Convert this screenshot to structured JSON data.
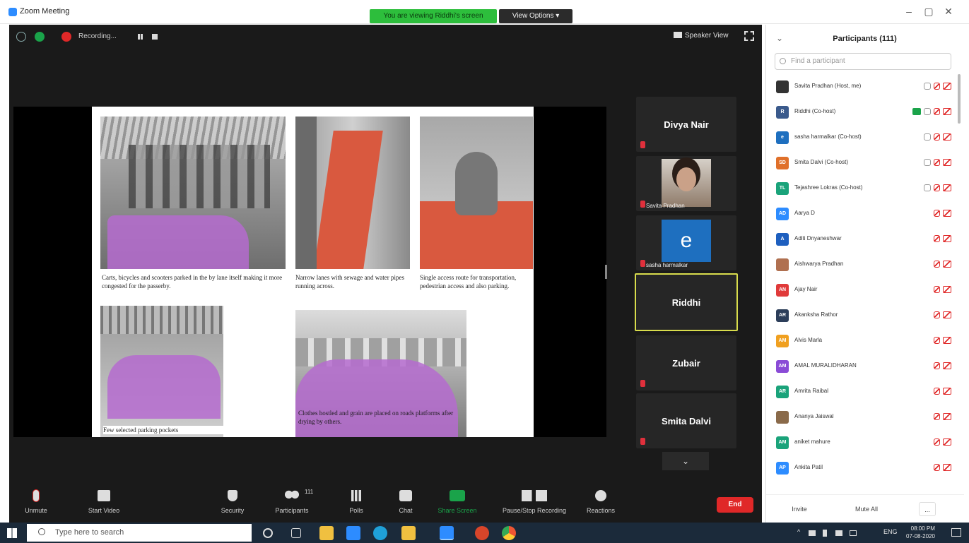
{
  "window": {
    "title": "Zoom Meeting",
    "share_banner": "You are viewing Riddhi's screen",
    "view_options": "View Options ▾",
    "minimize": "–",
    "maximize": "▢",
    "close": "✕"
  },
  "topbar": {
    "recording_label": "Recording...",
    "speaker_view": "Speaker View"
  },
  "slide": {
    "caption_1": "Carts, bicycles and scooters parked in the by lane itself making it more congested for the passerby.",
    "caption_2": "Narrow lanes with sewage and water pipes running across.",
    "caption_3": "Single access route for transportation, pedestrian access and also parking.",
    "caption_4": "Few selected parking pockets",
    "caption_5": "Clothes hostled and grain are placed on roads platforms after drying by others."
  },
  "gallery": {
    "tiles": [
      {
        "name": "Divya Nair"
      },
      {
        "name": "Savita Pradhan"
      },
      {
        "name": "e",
        "small_name": "sasha harmalkar"
      },
      {
        "name": "Riddhi"
      },
      {
        "name": "Zubair"
      },
      {
        "name": "Smita Dalvi"
      }
    ],
    "more": "⌄"
  },
  "toolbar": {
    "unmute": "Unmute",
    "start_video": "Start Video",
    "security": "Security",
    "participants": "Participants",
    "participants_count": "111",
    "polls": "Polls",
    "chat": "Chat",
    "share_screen": "Share Screen",
    "pause_stop_recording": "Pause/Stop Recording",
    "reactions": "Reactions",
    "end": "End"
  },
  "participants_panel": {
    "title": "Participants (111)",
    "search_placeholder": "Find a participant",
    "rows": [
      {
        "initials": "",
        "name": "Savita Pradhan (Host, me)",
        "color": "#333333",
        "photo": true
      },
      {
        "initials": "R",
        "name": "Riddhi (Co-host)",
        "color": "#3a5a8c"
      },
      {
        "initials": "e",
        "name": "sasha harmalkar (Co-host)",
        "color": "#1e6fbf"
      },
      {
        "initials": "SD",
        "name": "Smita Dalvi (Co-host)",
        "color": "#e0702a"
      },
      {
        "initials": "TL",
        "name": "Tejashree Lokras (Co-host)",
        "color": "#1aa37a"
      },
      {
        "initials": "AD",
        "name": "Aarya D",
        "color": "#2d8cff"
      },
      {
        "initials": "A",
        "name": "Aditi Dnyaneshwar",
        "color": "#1e5fbf"
      },
      {
        "initials": "",
        "name": "Aishwarya Pradhan",
        "color": "#b07050",
        "photo": true
      },
      {
        "initials": "AN",
        "name": "Ajay Nair",
        "color": "#e03a3a"
      },
      {
        "initials": "AR",
        "name": "Akanksha Rathor",
        "color": "#2c3e5a"
      },
      {
        "initials": "AM",
        "name": "Alvis Marla",
        "color": "#f0a020"
      },
      {
        "initials": "AM",
        "name": "AMAL MURALIDHARAN",
        "color": "#8a4bd6"
      },
      {
        "initials": "AR",
        "name": "Amrita Raibal",
        "color": "#1aa37a"
      },
      {
        "initials": "",
        "name": "Ananya Jaiswal",
        "color": "#8a6a4a",
        "photo": true
      },
      {
        "initials": "AM",
        "name": "aniket mahure",
        "color": "#1aa37a"
      },
      {
        "initials": "AP",
        "name": "Ankita Patil",
        "color": "#2d8cff"
      }
    ],
    "invite": "Invite",
    "mute_all": "Mute All",
    "more": "..."
  },
  "taskbar": {
    "search_placeholder": "Type here to search",
    "lang": "ENG",
    "time": "08:00 PM",
    "date": "07-08-2020"
  }
}
